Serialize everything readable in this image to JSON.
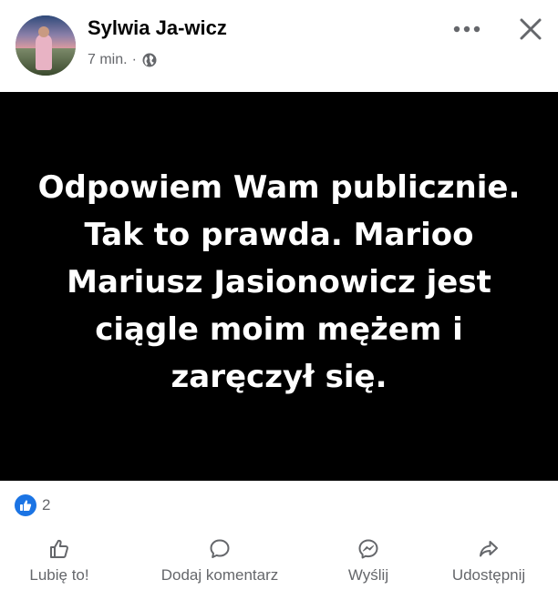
{
  "post": {
    "author": "Sylwia Ja-wicz",
    "time": "7 min.",
    "separator": "·",
    "text": "Odpowiem Wam publicznie. Tak to prawda. Marioo Mariusz Jasionowicz jest ciągle moim mężem i zaręczył się."
  },
  "reactions": {
    "count": "2",
    "type_icon": "like-icon"
  },
  "actions": [
    {
      "label": "Lubię to!",
      "icon": "thumbs-up-icon"
    },
    {
      "label": "Dodaj komentarz",
      "icon": "comment-icon"
    },
    {
      "label": "Wyślij",
      "icon": "messenger-icon"
    },
    {
      "label": "Udostępnij",
      "icon": "share-icon"
    }
  ],
  "colors": {
    "accent": "#1b74e4",
    "secondary_text": "#65676b",
    "image_background": "#000000"
  }
}
